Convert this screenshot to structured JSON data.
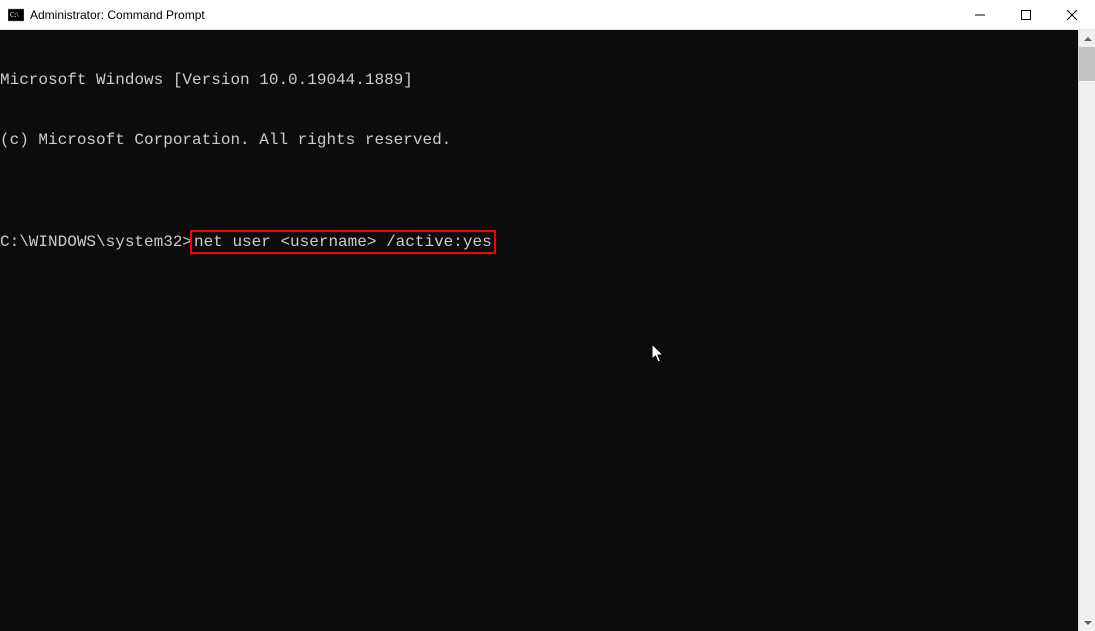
{
  "titlebar": {
    "title": "Administrator: Command Prompt"
  },
  "terminal": {
    "line1": "Microsoft Windows [Version 10.0.19044.1889]",
    "line2": "(c) Microsoft Corporation. All rights reserved.",
    "blank": "",
    "prompt": "C:\\WINDOWS\\system32>",
    "command": "net user <username> /active:yes"
  }
}
